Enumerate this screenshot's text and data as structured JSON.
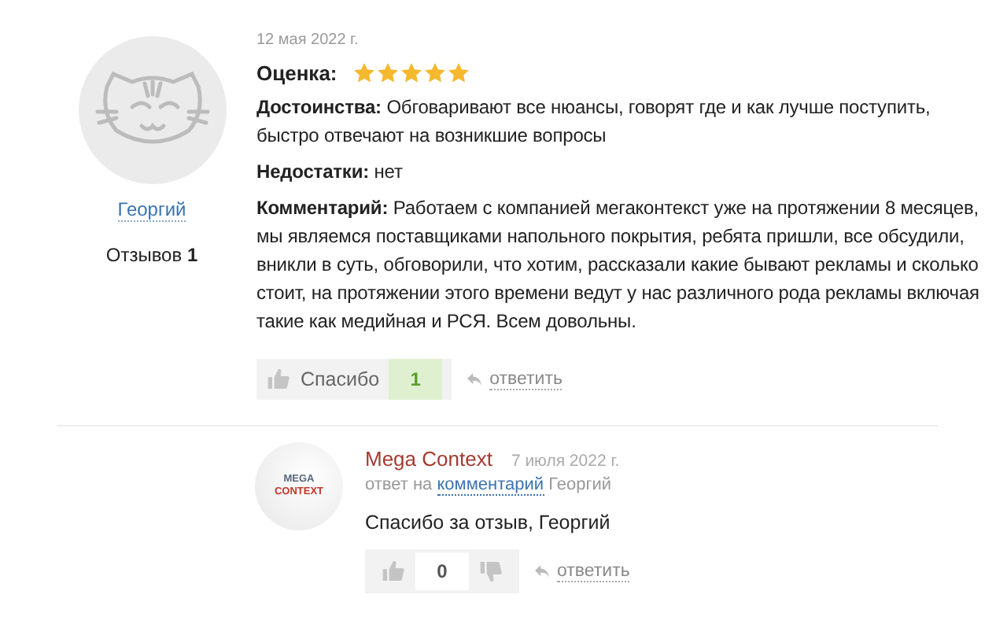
{
  "review": {
    "author": "Георгий",
    "reviews_label": "Отзывов",
    "reviews_count": "1",
    "date": "12 мая 2022 г.",
    "rating": {
      "label": "Оценка:",
      "stars": 5
    },
    "fields": [
      {
        "text": "**Достоинства:** Обговаривают все нюансы, говорят где и как лучше поступить, быстро отвечают на возникшие вопросы"
      },
      {
        "text": "**Недостатки:** нет"
      },
      {
        "text": "**Комментарий:** Работаем с компанией мегаконтекст уже на протяжении 8 месяцев, мы являемся поставщиками напольного покрытия, ребята пришли, все обсудили, вникли в суть, обговорили, что хотим, рассказали какие бывают рекламы и сколько стоит, на протяжении этого времени ведут у нас различного рода рекламы включая такие как медийная и РСЯ. Всем довольны."
      }
    ],
    "thanks_label": "Спасибо",
    "thanks_count": "1",
    "reply_link": "ответить"
  },
  "reply": {
    "logo_lines": [
      "MEGA",
      "CONTEXT"
    ],
    "author": "Mega Context",
    "date": "7 июля 2022 г.",
    "reply_to_prefix": "ответ на",
    "reply_to_link": "комментарий",
    "reply_to_name": "Георгий",
    "text": "Спасибо за отзыв, Георгий",
    "votes": "0",
    "reply_link": "ответить"
  }
}
